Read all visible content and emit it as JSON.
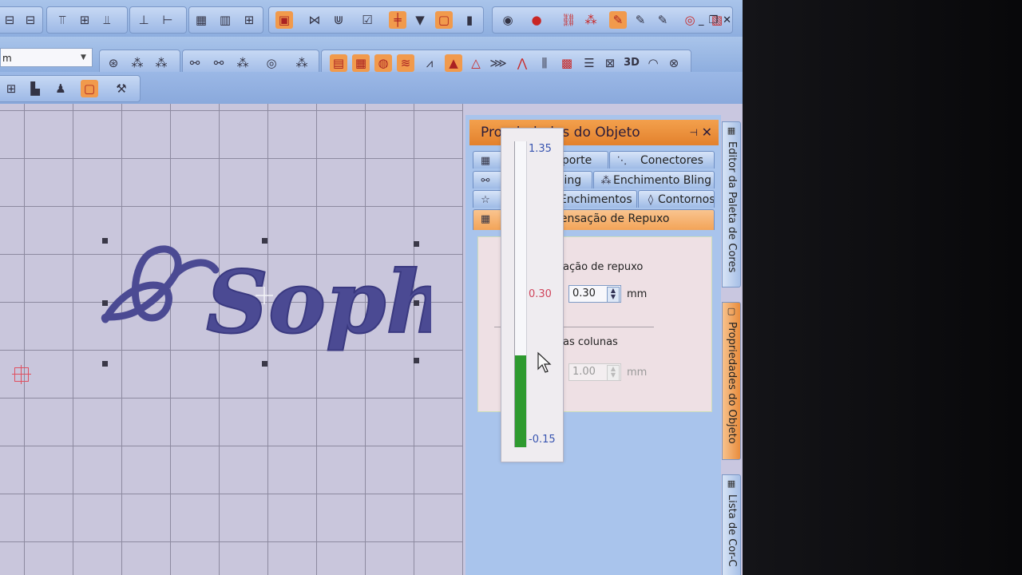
{
  "toolbar": {
    "font_combo_value": "m",
    "row1_icons": [
      "align-icon",
      "align-icon",
      "align-icon",
      "align-icon",
      "align-icon",
      "align-icon",
      "align-icon",
      "distribute-icon",
      "distribute-icon",
      "grid-icon",
      "grid-icon",
      "grid-icon",
      "select-box-icon",
      "reshape-icon",
      "reshape-icon",
      "checkbox-icon",
      "split-icon",
      "arrow-down-icon",
      "stitch-icon",
      "stitch-icon",
      "bucket-icon",
      "palette-icon",
      "color-circle-icon",
      "chain-icon",
      "bling-icon",
      "needle-icon",
      "needle-icon",
      "needle-icon",
      "record-icon",
      "frame-icon"
    ],
    "row2_icons": [
      "bling-fill-icon",
      "bling-fill-icon",
      "bling-fill-icon",
      "link-icon",
      "link-icon",
      "bling-fill-icon",
      "circle-icon",
      "bling-fill-icon",
      "fill-icon",
      "fill-icon",
      "fill-icon",
      "fill-icon",
      "fill-icon",
      "fill-icon",
      "fill-icon",
      "fill-icon",
      "fill-icon",
      "fill-icon",
      "fill-icon",
      "fill-icon",
      "fill-icon",
      "3d-icon",
      "hat-icon",
      "hat-icon"
    ],
    "row3_icons": [
      "stitch-icon",
      "building-icon",
      "person-icon",
      "object-properties-icon",
      "tool-icon"
    ],
    "label_3d": "3D"
  },
  "canvas": {
    "design_text": "Sophia",
    "thread_color": "#4b4a93"
  },
  "panel": {
    "title": "Propriedades do Objeto",
    "pin_icon": "pin-icon",
    "close_label": "✕",
    "tabs": [
      {
        "label": "Suporte",
        "icon": "fill-icon",
        "visible": "uporte"
      },
      {
        "label": "Conectores",
        "icon": "connector-icon",
        "visible": "Conectores"
      },
      {
        "label": "Bling",
        "icon": "bling-icon",
        "visible": "Bling"
      },
      {
        "label": "Enchimento Bling",
        "icon": "bling-fill-icon",
        "visible": "Enchimento Bling"
      },
      {
        "label": "Enchimentos",
        "icon": "star-icon",
        "visible": "Enchimentos"
      },
      {
        "label": "Contornos",
        "icon": "outline-icon",
        "visible": "Contornos"
      },
      {
        "label": "Compensação de Repuxo",
        "icon": "compensation-icon",
        "visible": "pensação de Repuxo"
      }
    ],
    "field1_label": "ação de repuxo",
    "field1_value": "0.30",
    "field1_unit": "mm",
    "field2_label": "as colunas",
    "field2_value": "1.00",
    "field2_unit": "mm"
  },
  "slider": {
    "max_label": "1.35",
    "current_label": "0.30",
    "min_label": "-0.15",
    "max": 1.35,
    "min": -0.15,
    "value": 0.3
  },
  "dock": {
    "tab1": "Editor da Paleta de Cores",
    "tab2": "Propriedades do Objeto",
    "tab3": "Lista de Cor-C"
  },
  "colors": {
    "panel_header": "#e9893a",
    "slider_fill": "#2e9a2f",
    "slider_current": "#d0455c"
  }
}
